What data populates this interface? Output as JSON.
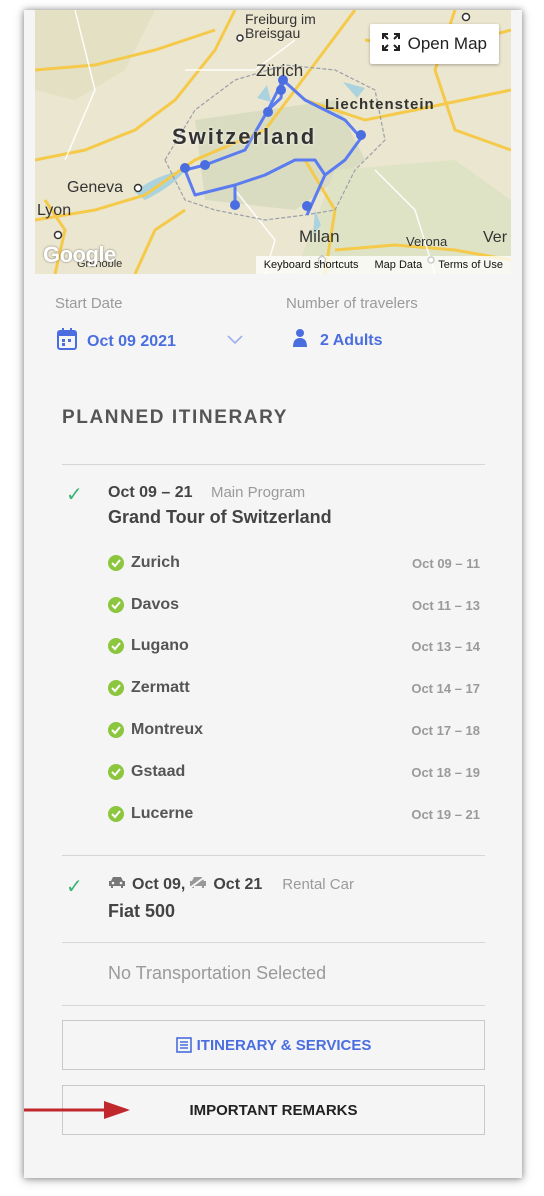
{
  "map": {
    "open_map_label": "Open Map",
    "places": {
      "freiburg": "Freiburg im\nBreisgau",
      "zurich": "Zürich",
      "liechtenstein": "Liechtenstein",
      "switzerland": "Switzerland",
      "geneva": "Geneva",
      "lyon": "Lyon",
      "milan": "Milan",
      "verona": "Verona",
      "ver": "Ver",
      "grenoble": "Grenoble"
    },
    "google_logo": "Google",
    "attribution": [
      "Keyboard shortcuts",
      "Map Data",
      "Terms of Use"
    ]
  },
  "booking": {
    "start_date_label": "Start Date",
    "start_date_value": "Oct 09 2021",
    "travelers_label": "Number of travelers",
    "travelers_value": "2 Adults"
  },
  "itinerary": {
    "title": "PLANNED ITINERARY",
    "program": {
      "dates": "Oct 09 – 21",
      "type": "Main Program",
      "name": "Grand Tour of Switzerland",
      "stops": [
        {
          "name": "Zurich",
          "dates": "Oct 09 – 11"
        },
        {
          "name": "Davos",
          "dates": "Oct 11 – 13"
        },
        {
          "name": "Lugano",
          "dates": "Oct 13 – 14"
        },
        {
          "name": "Zermatt",
          "dates": "Oct 14 – 17"
        },
        {
          "name": "Montreux",
          "dates": "Oct 17 – 18"
        },
        {
          "name": "Gstaad",
          "dates": "Oct 18 – 19"
        },
        {
          "name": "Lucerne",
          "dates": "Oct 19 – 21"
        }
      ]
    },
    "car": {
      "pickup": "Oct 09,",
      "dropoff": "Oct 21",
      "type": "Rental Car",
      "name": "Fiat 500"
    },
    "transport_placeholder": "No Transportation Selected",
    "services_button": "ITINERARY & SERVICES",
    "remarks_button": "IMPORTANT REMARKS"
  },
  "colors": {
    "accent": "#4a6ee0",
    "check": "#3cb371",
    "stop_dot": "#8cc63f",
    "arrow": "#c0282d"
  }
}
